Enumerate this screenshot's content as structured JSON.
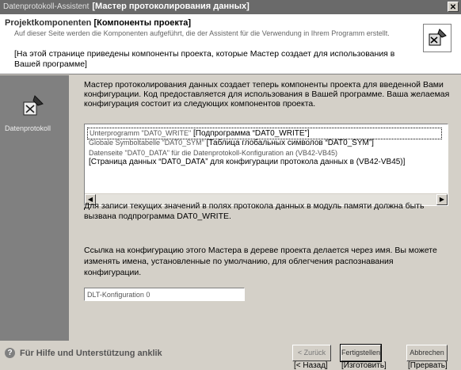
{
  "window": {
    "title_de": "Datenprotokoll-Assistent",
    "title_ru": "[Мастер протоколирования данных]"
  },
  "header": {
    "title_de": "Projektkomponenten",
    "title_ru": "[Компоненты проекта]",
    "desc_de": "Auf dieser Seite werden die Komponenten aufgeführt, die der Assistent für die Verwendung in Ihrem Programm erstellt.",
    "desc_de_tail": "erstellt.",
    "desc_ru": "[На этой странице приведены компоненты проекта, которые Мастер создает для использования в Вашей программе]"
  },
  "sidebar": {
    "label": "Datenprotokoll"
  },
  "main": {
    "intro": "Мастер протоколирования данных создает теперь компоненты проекта для введенной Вами конфигурации. Код предоставляется для использования в Вашей программе. Ваша желаемая конфигурация состоит из следующих компонентов проекта.",
    "components": [
      {
        "de": "Unterprogramm \"DAT0_WRITE\"",
        "ru": "[Подпрограмма “DAT0_WRITE”]"
      },
      {
        "de": "Globale Symboltabelle \"DAT0_SYM\"",
        "ru": "[Таблица глобальных символов “DAT0_SYM”]"
      },
      {
        "de": "Datenseite \"DAT0_DATA\" für die Datenprotokoll-Konfiguration an (VB42-VB45)",
        "ru": ""
      },
      {
        "de": "",
        "ru": "[Страница данных “DAT0_DATA” для конфигурации протокола данных в (VB42-VB45)]"
      }
    ],
    "note": "Для записи текущих значений в полях протокола данных в модуль памяти должна быть вызвана подпрограмма DAT0_WRITE.",
    "config_text": "Ссылка на конфигурацию этого Мастера в дереве проекта делается через имя. Вы можете изменять имена, установленные по умолчанию, для облегчения распознавания конфигурации.",
    "config_name_value": "DLT-Konfiguration 0"
  },
  "footer": {
    "help_text": "Für Hilfe und Unterstützung anklik",
    "back_label": "< Zurück",
    "finish_label": "Fertigstellen",
    "cancel_label": "Abbrechen",
    "back_ru": "[< Назад]",
    "finish_ru": "[Изготовить]",
    "cancel_ru": "[Прервать]"
  }
}
